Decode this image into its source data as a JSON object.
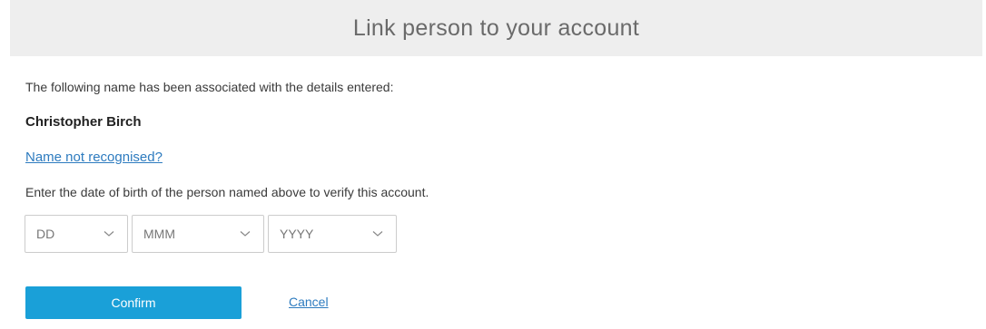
{
  "dialog": {
    "title": "Link person to your account",
    "intro_text": "The following name has been associated with the details entered:",
    "person_name": "Christopher Birch",
    "not_recognised_link": "Name not recognised?",
    "instruction_text": "Enter the date of birth of the person named above to verify this account."
  },
  "dob": {
    "day": {
      "value": "DD",
      "icon": "chevron-down-icon"
    },
    "month": {
      "value": "MMM",
      "icon": "chevron-down-icon"
    },
    "year": {
      "value": "YYYY",
      "icon": "chevron-down-icon"
    }
  },
  "actions": {
    "confirm_label": "Confirm",
    "cancel_label": "Cancel"
  },
  "colors": {
    "header_background": "#eeeeee",
    "primary_button": "#1aa0d8",
    "link": "#2d7bbf"
  }
}
